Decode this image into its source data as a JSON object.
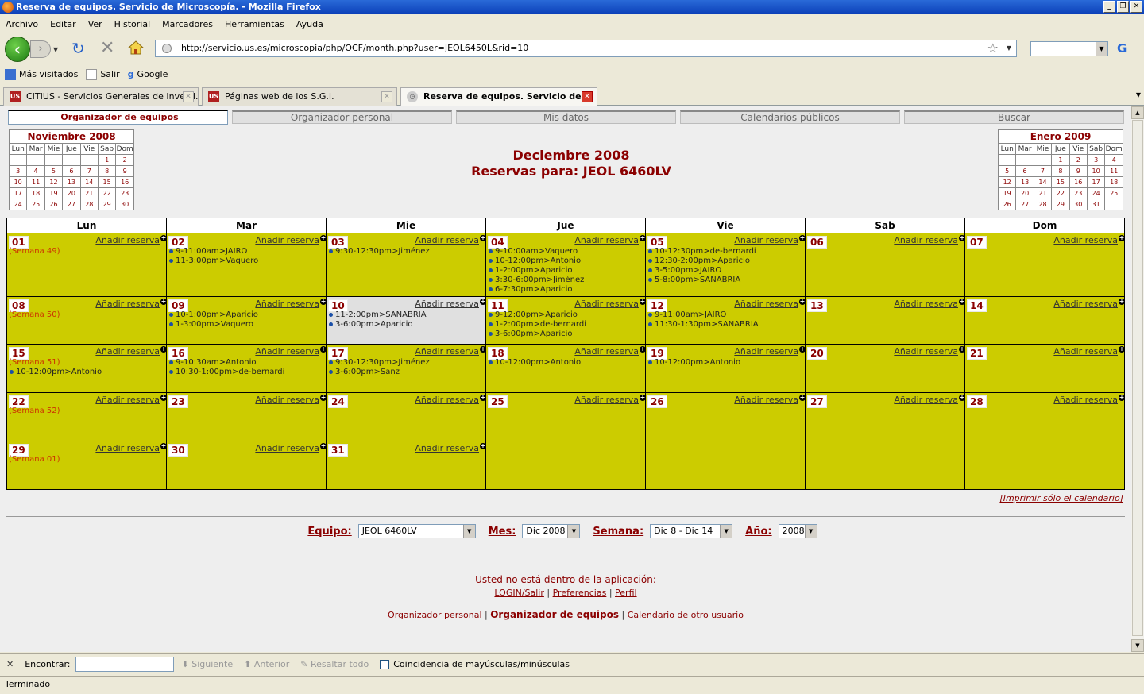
{
  "window": {
    "title": "Reserva de equipos. Servicio de Microscopía. - Mozilla Firefox"
  },
  "menu": [
    "Archivo",
    "Editar",
    "Ver",
    "Historial",
    "Marcadores",
    "Herramientas",
    "Ayuda"
  ],
  "url": "http://servicio.us.es/microscopia/php/OCF/month.php?user=JEOL6450L&rid=10",
  "bookmarks": [
    "Más visitados",
    "Salir",
    "Google"
  ],
  "tabs": [
    "CITIUS - Servicios Generales de Investi...",
    "Páginas web de los S.G.I.",
    "Reserva de equipos. Servicio de ..."
  ],
  "app_tabs": [
    "Organizador de equipos",
    "Organizador personal",
    "Mis datos",
    "Calendarios públicos",
    "Buscar"
  ],
  "prev_month": {
    "title": "Noviembre 2008",
    "weeks": [
      [
        "",
        "",
        "",
        "",
        "",
        "1",
        "2"
      ],
      [
        "3",
        "4",
        "5",
        "6",
        "7",
        "8",
        "9"
      ],
      [
        "10",
        "11",
        "12",
        "13",
        "14",
        "15",
        "16"
      ],
      [
        "17",
        "18",
        "19",
        "20",
        "21",
        "22",
        "23"
      ],
      [
        "24",
        "25",
        "26",
        "27",
        "28",
        "29",
        "30"
      ]
    ]
  },
  "next_month": {
    "title": "Enero 2009",
    "weeks": [
      [
        "",
        "",
        "1",
        "2",
        "3",
        "4"
      ],
      [
        "5",
        "6",
        "7",
        "8",
        "9",
        "10",
        "11"
      ],
      [
        "12",
        "13",
        "14",
        "15",
        "16",
        "17",
        "18"
      ],
      [
        "19",
        "20",
        "21",
        "22",
        "23",
        "24",
        "25"
      ],
      [
        "26",
        "27",
        "28",
        "29",
        "30",
        "31",
        ""
      ]
    ]
  },
  "day_abbr": [
    "Lun",
    "Mar",
    "Mie",
    "Jue",
    "Vie",
    "Sab",
    "Dom"
  ],
  "heading": {
    "month": "Deciembre 2008",
    "reservas": "Reservas para: JEOL 6460LV"
  },
  "days": [
    "Lun",
    "Mar",
    "Mie",
    "Jue",
    "Vie",
    "Sab",
    "Dom"
  ],
  "add_label": "Añadir reserva",
  "calendar": [
    [
      {
        "d": "01",
        "sem": "(Semana 49)",
        "ev": []
      },
      {
        "d": "02",
        "ev": [
          "9-11:00am>JAIRO",
          "11-3:00pm>Vaquero"
        ]
      },
      {
        "d": "03",
        "ev": [
          "9:30-12:30pm>Jiménez"
        ]
      },
      {
        "d": "04",
        "ev": [
          "9-10:00am>Vaquero",
          "10-12:00pm>Antonio",
          "1-2:00pm>Aparicio",
          "3:30-6:00pm>Jiménez",
          "6-7:30pm>Aparicio"
        ]
      },
      {
        "d": "05",
        "ev": [
          "10-12:30pm>de-bernardi",
          "12:30-2:00pm>Aparicio",
          "3-5:00pm>JAIRO",
          "5-8:00pm>SANABRIA"
        ]
      },
      {
        "d": "06",
        "ev": []
      },
      {
        "d": "07",
        "ev": []
      }
    ],
    [
      {
        "d": "08",
        "sem": "(Semana 50)",
        "ev": []
      },
      {
        "d": "09",
        "ev": [
          "10-1:00pm>Aparicio",
          "1-3:00pm>Vaquero"
        ]
      },
      {
        "d": "10",
        "today": true,
        "ev": [
          "11-2:00pm>SANABRIA",
          "3-6:00pm>Aparicio"
        ]
      },
      {
        "d": "11",
        "ev": [
          "9-12:00pm>Aparicio",
          "1-2:00pm>de-bernardi",
          "3-6:00pm>Aparicio"
        ]
      },
      {
        "d": "12",
        "ev": [
          "9-11:00am>JAIRO",
          "11:30-1:30pm>SANABRIA"
        ]
      },
      {
        "d": "13",
        "ev": []
      },
      {
        "d": "14",
        "ev": []
      }
    ],
    [
      {
        "d": "15",
        "sem": "(Semana 51)",
        "ev": [
          "10-12:00pm>Antonio"
        ]
      },
      {
        "d": "16",
        "ev": [
          "9-10:30am>Antonio",
          "10:30-1:00pm>de-bernardi"
        ]
      },
      {
        "d": "17",
        "ev": [
          "9:30-12:30pm>Jiménez",
          "3-6:00pm>Sanz"
        ]
      },
      {
        "d": "18",
        "ev": [
          "10-12:00pm>Antonio"
        ]
      },
      {
        "d": "19",
        "ev": [
          "10-12:00pm>Antonio"
        ]
      },
      {
        "d": "20",
        "ev": []
      },
      {
        "d": "21",
        "ev": []
      }
    ],
    [
      {
        "d": "22",
        "sem": "(Semana 52)",
        "ev": []
      },
      {
        "d": "23",
        "ev": []
      },
      {
        "d": "24",
        "ev": []
      },
      {
        "d": "25",
        "ev": []
      },
      {
        "d": "26",
        "ev": []
      },
      {
        "d": "27",
        "ev": []
      },
      {
        "d": "28",
        "ev": []
      }
    ],
    [
      {
        "d": "29",
        "sem": "(Semana 01)",
        "ev": []
      },
      {
        "d": "30",
        "ev": []
      },
      {
        "d": "31",
        "ev": []
      },
      {
        "d": "",
        "ev": []
      },
      {
        "d": "",
        "ev": []
      },
      {
        "d": "",
        "ev": []
      },
      {
        "d": "",
        "ev": []
      }
    ]
  ],
  "print_link": "[Imprimir sólo el calendario]",
  "selectors": {
    "equipo_label": "Equipo:",
    "equipo": "JEOL 6460LV",
    "mes_label": "Mes:",
    "mes": "Dic 2008",
    "semana_label": "Semana:",
    "semana": "Dic 8 - Dic 14",
    "anio_label": "Año:",
    "anio": "2008"
  },
  "footer": {
    "msg": "Usted no está dentro de la aplicación:",
    "login": "LOGIN/Salir",
    "prefs": "Preferencias",
    "perfil": "Perfil",
    "org_personal": "Organizador personal",
    "org_equipos": "Organizador de equipos",
    "cal_otro": "Calendario de otro usuario"
  },
  "findbar": {
    "label": "Encontrar:",
    "next": "Siguiente",
    "prev": "Anterior",
    "highlight": "Resaltar todo",
    "match_case": "Coincidencia de mayúsculas/minúsculas"
  },
  "status": "Terminado"
}
